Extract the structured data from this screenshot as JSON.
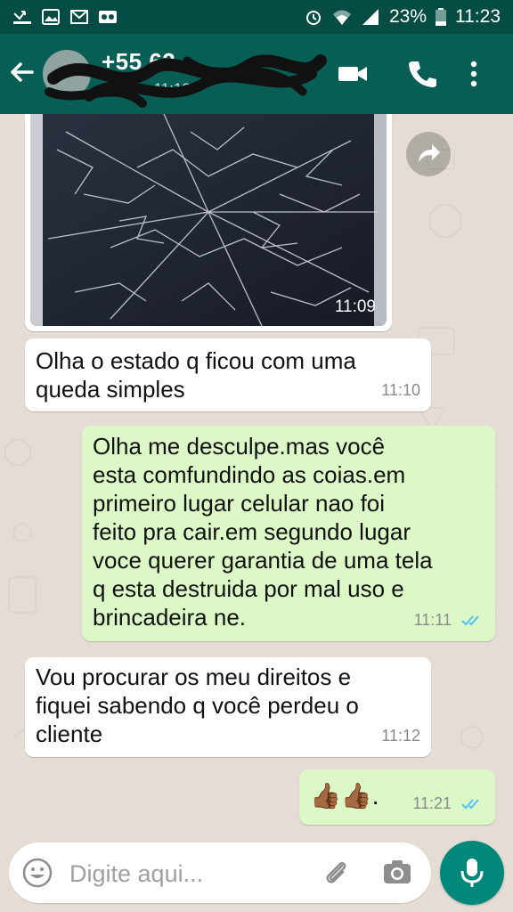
{
  "status_bar": {
    "battery": "23%",
    "time": "11:23"
  },
  "header": {
    "contact_name": "+55 62",
    "contact_status": "visto ... 11:12"
  },
  "messages": [
    {
      "type": "image",
      "direction": "in",
      "time": "11:09"
    },
    {
      "direction": "in",
      "lines": [
        "Olha o estado q ficou com uma",
        "queda simples"
      ],
      "time": "11:10"
    },
    {
      "direction": "out",
      "lines": [
        "Olha me desculpe.mas você",
        "esta comfundindo as coias.em",
        "primeiro lugar celular nao foi",
        "feito pra cair.em segundo lugar",
        "voce querer garantia de uma tela",
        "q esta destruida por mal uso e",
        "brincadeira ne."
      ],
      "time": "11:11"
    },
    {
      "direction": "in",
      "lines": [
        "Vou procurar os meu direitos e",
        "fiquei sabendo q você perdeu o",
        "cliente"
      ],
      "time": "11:12"
    },
    {
      "direction": "out",
      "text": "👍🏾👍🏾.",
      "time": "11:21"
    }
  ],
  "input": {
    "placeholder": "Digite aqui..."
  },
  "colors": {
    "header": "#075E54",
    "status_bar": "#054D44",
    "outgoing_bubble": "#DCF8C6",
    "incoming_bubble": "#FFFFFF",
    "read_ticks": "#4FC3F7",
    "mic_button": "#00897B"
  },
  "icons": [
    "back-arrow-icon",
    "video-call-icon",
    "phone-icon",
    "more-vert-icon",
    "forward-icon",
    "emoji-icon",
    "attach-icon",
    "camera-icon",
    "mic-icon",
    "double-check-icon"
  ]
}
